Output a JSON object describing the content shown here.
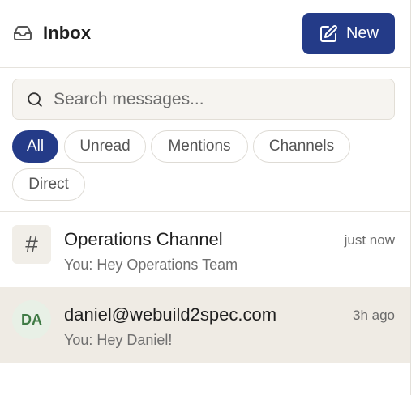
{
  "header": {
    "title": "Inbox",
    "new_button_label": "New"
  },
  "search": {
    "placeholder": "Search messages...",
    "value": ""
  },
  "filters": {
    "selected": "All",
    "items": [
      "All",
      "Unread",
      "Mentions",
      "Channels",
      "Direct"
    ]
  },
  "conversations": [
    {
      "type": "channel",
      "avatar_text": "#",
      "name": "Operations Channel",
      "time": "just now",
      "preview": "You: Hey Operations Team",
      "selected": false
    },
    {
      "type": "direct",
      "avatar_text": "DA",
      "name": "daniel@webuild2spec.com",
      "time": "3h ago",
      "preview": "You: Hey Daniel!",
      "selected": true
    }
  ],
  "icons": {
    "inbox": "inbox-icon",
    "new": "edit-icon",
    "search": "search-icon"
  },
  "colors": {
    "accent": "#243b88",
    "selected_row": "#efebe4",
    "avatar_person_bg": "#e8f0e6",
    "avatar_person_text": "#3f7a45"
  }
}
